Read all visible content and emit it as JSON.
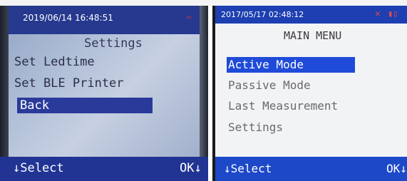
{
  "left_screen": {
    "datetime": "2019/06/14 16:48:51",
    "title": "Settings",
    "items": [
      {
        "label": "Set Ledtime",
        "selected": false
      },
      {
        "label": "Set BLE Printer",
        "selected": false
      },
      {
        "label": "Back",
        "selected": true
      }
    ],
    "footer": {
      "select_label": "↓Select",
      "ok_label": "OK↓"
    }
  },
  "right_screen": {
    "datetime": "2017/05/17 02:48:12",
    "title": "MAIN MENU",
    "items": [
      {
        "label": "Active Mode",
        "selected": true
      },
      {
        "label": "Passive Mode",
        "selected": false
      },
      {
        "label": "Last Measurement",
        "selected": false
      },
      {
        "label": "Settings",
        "selected": false
      }
    ],
    "footer": {
      "select_label": "↓Select",
      "ok_label": "OK↓"
    }
  },
  "colors": {
    "bar_blue_left": "#213494",
    "bar_blue_right": "#1d49c9",
    "highlight_left": "#2a3a9a",
    "highlight_right": "#1f4bd8",
    "indicator_red": "#e04a4a"
  }
}
